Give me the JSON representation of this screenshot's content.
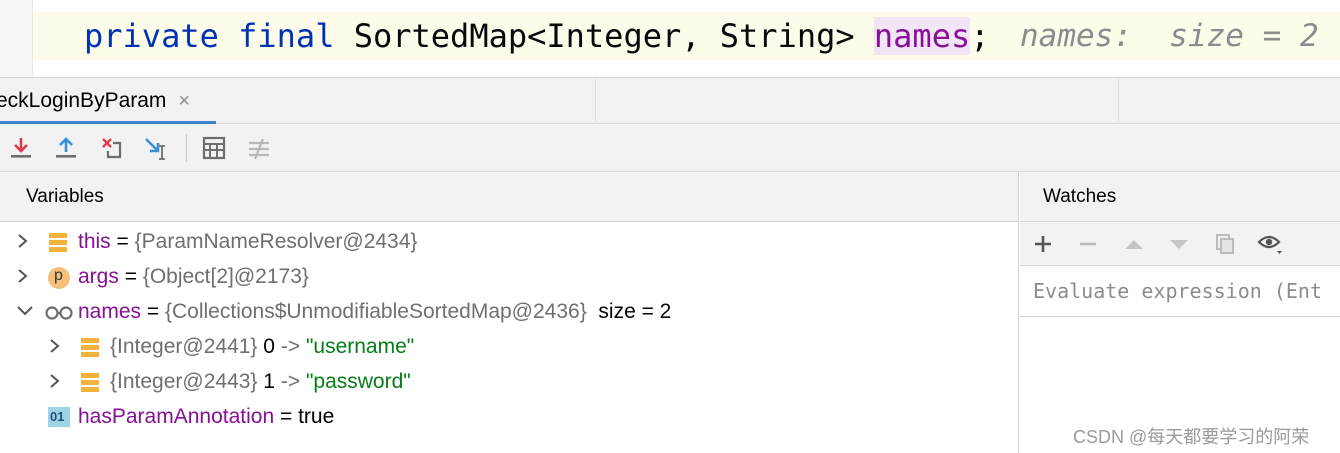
{
  "editor": {
    "code": {
      "kw_private": "private",
      "kw_final": "final",
      "type": "SortedMap<Integer, String>",
      "field": "names",
      "semicolon": ";"
    },
    "inline_hint": "names:  size = 2"
  },
  "tab": {
    "label": "eckLoginByParam",
    "close": "×"
  },
  "toolbar": {
    "icons": [
      "step-into-icon",
      "step-out-icon",
      "drop-frame-icon",
      "run-to-cursor-icon",
      "evaluate-expression-icon",
      "trace-current-stream-icon"
    ]
  },
  "variables": {
    "title": "Variables",
    "rows": [
      {
        "name": "this",
        "eq": "=",
        "value": "{ParamNameResolver@2434}",
        "icon": "field-icon",
        "expanded": false
      },
      {
        "name": "args",
        "eq": "=",
        "value": "{Object[2]@2173}",
        "icon": "param-icon",
        "icon_text": "p",
        "expanded": false
      },
      {
        "name": "names",
        "eq": "=",
        "value": "{Collections$UnmodifiableSortedMap@2436}",
        "extra": "size = 2",
        "icon": "watch-glasses-icon",
        "expanded": true
      },
      {
        "key": "{Integer@2441}",
        "index": "0",
        "arrow": "->",
        "str": "\"username\"",
        "icon": "field-icon",
        "expanded": false
      },
      {
        "key": "{Integer@2443}",
        "index": "1",
        "arrow": "->",
        "str": "\"password\"",
        "icon": "field-icon",
        "expanded": false
      },
      {
        "name": "hasParamAnnotation",
        "eq": "=",
        "value": "true",
        "icon": "boolean-icon",
        "icon_text": "01"
      }
    ]
  },
  "watches": {
    "title": "Watches",
    "placeholder": "Evaluate expression (Ent"
  },
  "watermark": "CSDN @每天都要学习的阿荣",
  "colors": {
    "keyword": "#0033b3",
    "field": "#871094",
    "string": "#067d17",
    "accent": "#4083c9"
  }
}
